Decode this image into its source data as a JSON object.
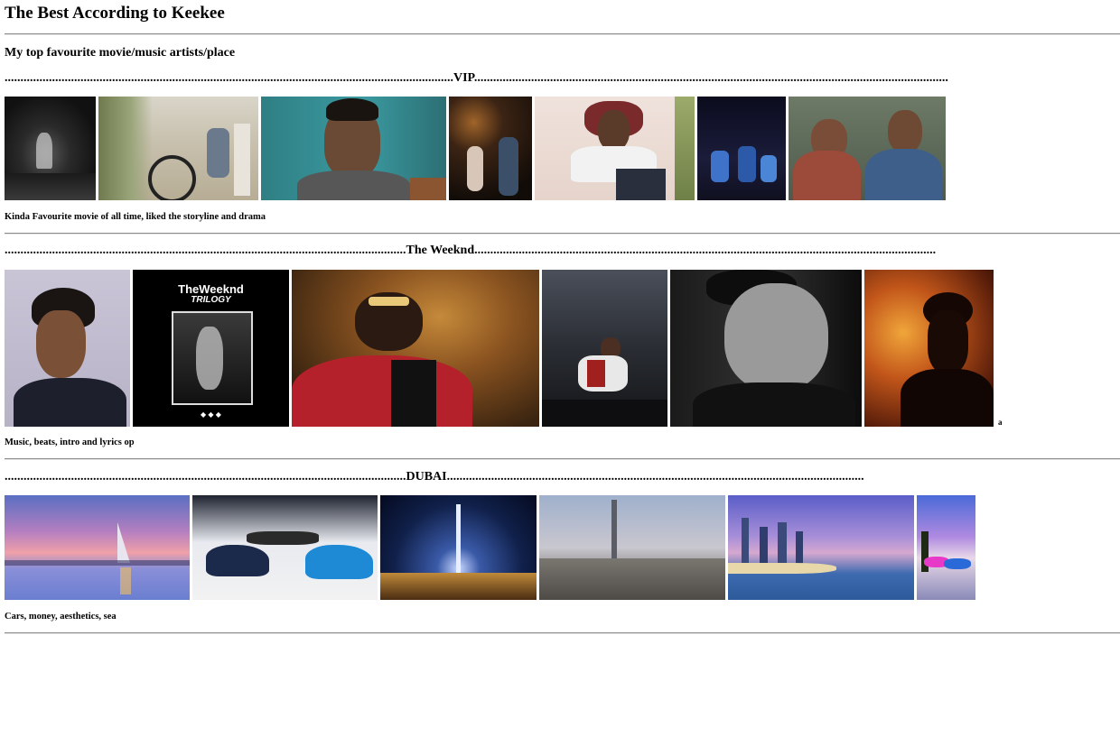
{
  "page": {
    "title": "The Best According to Keekee",
    "subtitle": "My top favourite movie/music artists/place"
  },
  "sections": [
    {
      "heading": "..............................................................................................................................................VIP......................................................................................................................................................",
      "heading_label": "VIP",
      "caption": "Kinda Favourite movie of all time, liked the storyline and drama",
      "images": [
        {
          "name": "vip-photo-1",
          "subject": "crowd-dance-night"
        },
        {
          "name": "vip-photo-2",
          "subject": "man-with-moped-gate"
        },
        {
          "name": "vip-photo-3",
          "subject": "man-portrait-teal-wall"
        },
        {
          "name": "vip-photo-4",
          "subject": "couple-night-street"
        },
        {
          "name": "vip-photo-5",
          "subject": "man-reclining-chair"
        },
        {
          "name": "vip-photo-6",
          "subject": "dancers-night"
        },
        {
          "name": "vip-photo-7",
          "subject": "mother-and-son"
        }
      ]
    },
    {
      "heading": "...............................................................................................................................The Weeknd..................................................................................................................................................",
      "heading_label": "The Weeknd",
      "caption": "Music, beats, intro and lyrics op",
      "stray_mark": "a",
      "images": [
        {
          "name": "weeknd-photo-1",
          "subject": "weeknd-portrait"
        },
        {
          "name": "weeknd-photo-2",
          "subject": "trilogy-album-cover",
          "cover_brand": "TheWeeknd",
          "cover_title": "TRILOGY",
          "cover_dots": "◆ ◆ ◆"
        },
        {
          "name": "weeknd-photo-3",
          "subject": "red-suit-sunglasses"
        },
        {
          "name": "weeknd-photo-4",
          "subject": "concert-performance"
        },
        {
          "name": "weeknd-photo-5",
          "subject": "smiling-black-white"
        },
        {
          "name": "weeknd-photo-6",
          "subject": "silhouette-orange-smoke"
        }
      ]
    },
    {
      "heading": "...............................................................................................................................DUBAI....................................................................................................................................",
      "heading_label": "DUBAI",
      "caption": "Cars, money, aesthetics, sea",
      "images": [
        {
          "name": "dubai-photo-1",
          "subject": "burj-al-arab-sunset"
        },
        {
          "name": "dubai-photo-2",
          "subject": "bugatti-showroom"
        },
        {
          "name": "dubai-photo-3",
          "subject": "burj-khalifa-lights"
        },
        {
          "name": "dubai-photo-4",
          "subject": "city-skyline-dawn"
        },
        {
          "name": "dubai-photo-5",
          "subject": "marina-beach"
        },
        {
          "name": "dubai-photo-6",
          "subject": "supercars-palm"
        }
      ]
    }
  ],
  "colors": {
    "rule": "#8a8a8a",
    "text": "#000000",
    "background": "#ffffff"
  }
}
